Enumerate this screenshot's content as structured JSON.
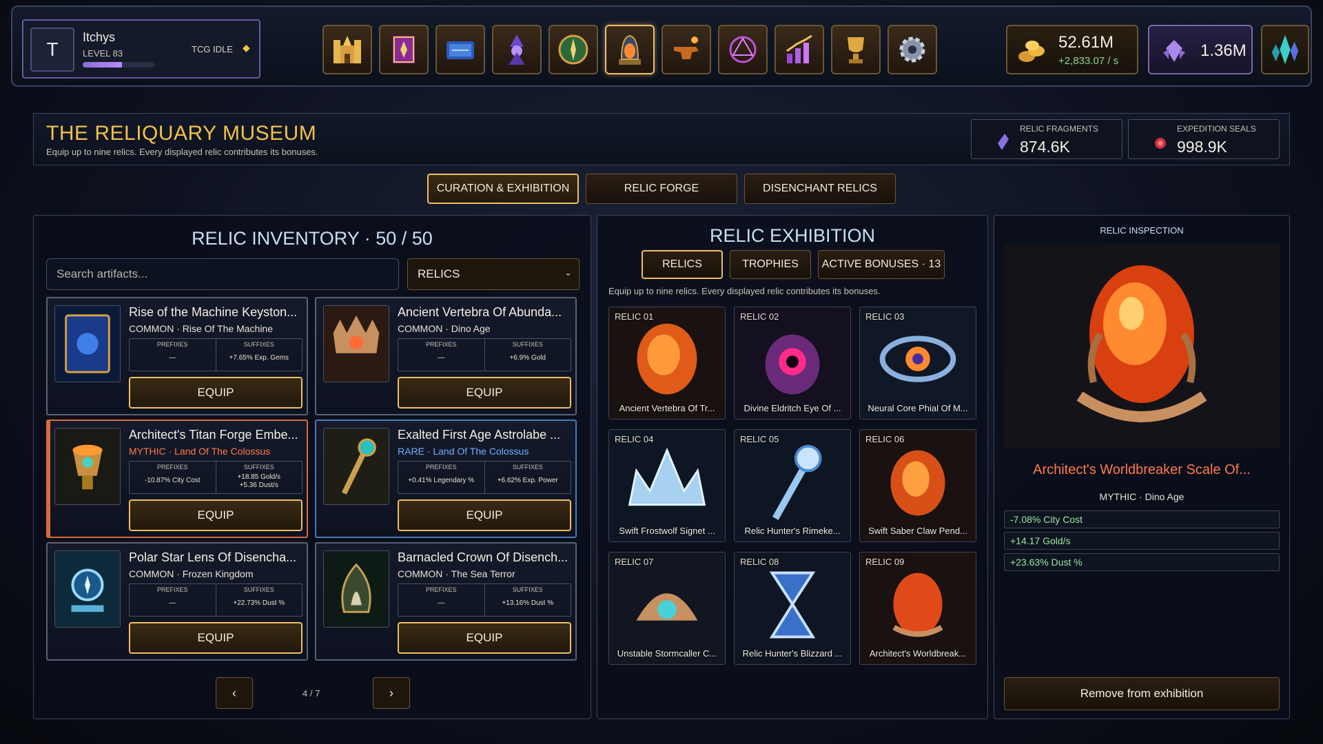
{
  "profile": {
    "avatar_letter": "T",
    "name": "Itchys",
    "level": "LEVEL 83",
    "xp_fraction": 0.55,
    "game_name": "TCG IDLE",
    "game_icon": "diamond-icon"
  },
  "nav": {
    "buttons": [
      {
        "name": "castle-icon"
      },
      {
        "name": "spellbook-icon"
      },
      {
        "name": "cards-icon"
      },
      {
        "name": "wizard-icon"
      },
      {
        "name": "compass-icon"
      },
      {
        "name": "relic-egg-icon",
        "active": true
      },
      {
        "name": "anvil-icon"
      },
      {
        "name": "rune-circle-icon"
      },
      {
        "name": "upgrade-chart-icon"
      },
      {
        "name": "trophy-icon"
      },
      {
        "name": "gear-icon"
      }
    ]
  },
  "currency": {
    "gold_value": "52.61M",
    "gold_rate": "+2,833.07 / s",
    "dust_value": "1.36M",
    "gold_icon": "gold-coins-icon",
    "dust_icon": "dust-crystal-icon",
    "crystal_icon": "crystal-cluster-icon"
  },
  "museum": {
    "title": "THE RELIQUARY MUSEUM",
    "subtitle": "Equip up to nine relics. Every displayed relic contributes its bonuses.",
    "fragments_label": "RELIC FRAGMENTS",
    "fragments_value": "874.6K",
    "seals_label": "EXPEDITION SEALS",
    "seals_value": "998.9K"
  },
  "tabs": [
    "CURATION & EXHIBITION",
    "RELIC FORGE",
    "DISENCHANT RELICS"
  ],
  "inventory": {
    "title": "RELIC INVENTORY · 50 / 50",
    "search_placeholder": "Search artifacts...",
    "filter_value": "RELICS",
    "prefix_header": "PREFIXES",
    "suffix_header": "SUFFIXES",
    "equip_label": "EQUIP",
    "cards": [
      {
        "name": "Rise of the Machine Keyston...",
        "tag": "COMMON · Rise Of The Machine",
        "rarity": "common",
        "prefix": "—",
        "suffix": "+7.65% Exp. Gems"
      },
      {
        "name": "Ancient Vertebra Of Abunda...",
        "tag": "COMMON · Dino Age",
        "rarity": "common",
        "prefix": "—",
        "suffix": "+6.9% Gold"
      },
      {
        "name": "Architect's Titan Forge Embe...",
        "tag_rarity": "MYTHIC",
        "tag_source": "Land Of The Colossus",
        "rarity": "mythic",
        "prefix": "-10.87% City Cost",
        "suffix": "+18.85 Gold/s",
        "suffix2": "+5.36 Dust/s"
      },
      {
        "name": "Exalted First Age Astrolabe ...",
        "tag_rarity": "RARE",
        "tag_source": "Land Of The Colossus",
        "rarity": "rare",
        "prefix": "+0.41% Legendary %",
        "suffix": "+6.62% Exp. Power"
      },
      {
        "name": "Polar Star Lens Of Disencha...",
        "tag": "COMMON · Frozen Kingdom",
        "rarity": "common",
        "prefix": "—",
        "suffix": "+22.73% Dust %"
      },
      {
        "name": "Barnacled Crown Of Disench...",
        "tag": "COMMON · The Sea Terror",
        "rarity": "common",
        "prefix": "—",
        "suffix": "+13.16% Dust %"
      }
    ],
    "pager": {
      "prev": "‹",
      "page": "4 / 7",
      "next": "›"
    }
  },
  "exhibition": {
    "title": "RELIC EXHIBITION",
    "subtabs": [
      "RELICS",
      "TROPHIES",
      "ACTIVE BONUSES · 13"
    ],
    "hint": "Equip up to nine relics. Every displayed relic contributes its bonuses.",
    "slots": [
      {
        "label": "RELIC 01",
        "name": "Ancient Vertebra Of Tr..."
      },
      {
        "label": "RELIC 02",
        "name": "Divine Eldritch Eye Of ..."
      },
      {
        "label": "RELIC 03",
        "name": "Neural Core Phial Of M..."
      },
      {
        "label": "RELIC 04",
        "name": "Swift Frostwolf Signet ..."
      },
      {
        "label": "RELIC 05",
        "name": "Relic Hunter's Rimeke..."
      },
      {
        "label": "RELIC 06",
        "name": "Swift Saber Claw Pend..."
      },
      {
        "label": "RELIC 07",
        "name": "Unstable Stormcaller C..."
      },
      {
        "label": "RELIC 08",
        "name": "Relic Hunter's Blizzard ..."
      },
      {
        "label": "RELIC 09",
        "name": "Architect's Worldbreak..."
      }
    ]
  },
  "inspection": {
    "title": "RELIC INSPECTION",
    "name": "Architect's Worldbreaker Scale Of...",
    "tag": "MYTHIC · Dino Age",
    "bonuses": [
      "-7.08% City Cost",
      "+14.17 Gold/s",
      "+23.63% Dust %"
    ],
    "remove_label": "Remove from exhibition"
  },
  "colors": {
    "accent_gold": "#f0c060",
    "mythic": "#ff7a4a",
    "rare": "#6fb0ff",
    "bonus_green": "#9be7a0"
  }
}
